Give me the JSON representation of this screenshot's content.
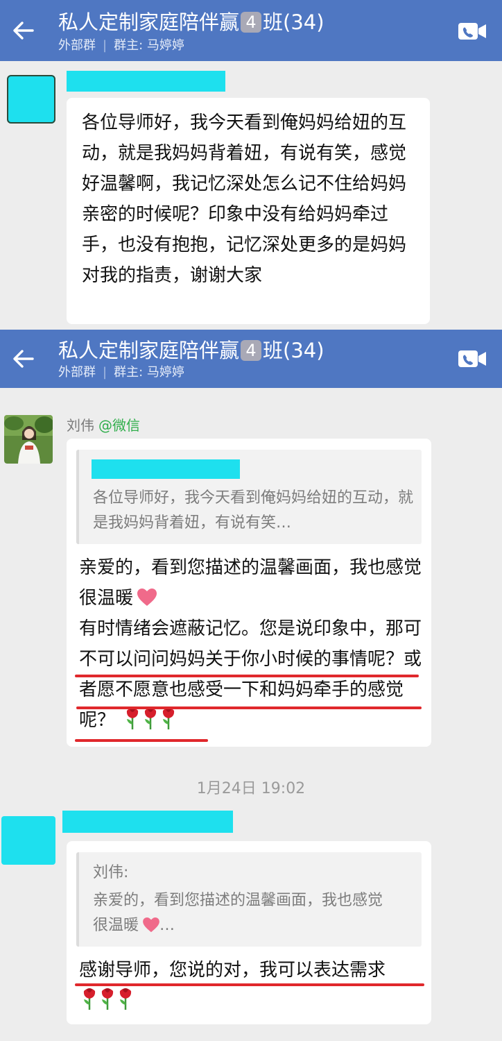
{
  "header": {
    "title_prefix": "私人定制家庭陪伴赢",
    "title_digit": "4",
    "title_suffix": "班(34)",
    "tag": "外部群",
    "owner": "群主: 马婷婷"
  },
  "messages": [
    {
      "text": "各位导师好，我今天看到俺妈妈给妞的互动，就是我妈妈背着妞，有说有笑，感觉好温馨啊，我记忆深处怎么记不住给妈妈亲密的时候呢？印象中没有给妈妈牵过手，也没有抱抱，记忆深处更多的是妈妈对我的指责，谢谢大家"
    },
    {
      "sender_name": "刘伟",
      "sender_source": "@微信",
      "quote_text": "各位导师好，我今天看到俺妈妈给妞的互动，就是我妈妈背着妞，有说有笑…",
      "text_line1": "亲爱的，看到您描述的温馨画面，我也感觉很温暖",
      "text_line2": "有时情绪会遮蔽记忆。您是说印象中，那可不可以问问妈妈关于你小时候的事情呢？或者愿不愿意也感受一下和妈妈牵手的感觉呢？"
    },
    {
      "quote_author": "刘伟:",
      "quote_text": "亲爱的，看到您描述的温馨画面，我也感觉很温暖",
      "quote_ellipsis": "…",
      "text": "感谢导师，您说的对，我可以表达需求"
    }
  ],
  "timestamp": "1月24日 19:02",
  "colors": {
    "header_bg": "#4f77c2",
    "redaction": "#1ee0ee",
    "underline": "#e0282c",
    "wechat_tag": "#2fae4b"
  },
  "icons": [
    "back-arrow-icon",
    "video-call-icon",
    "heart-emoji",
    "rose-emoji"
  ]
}
